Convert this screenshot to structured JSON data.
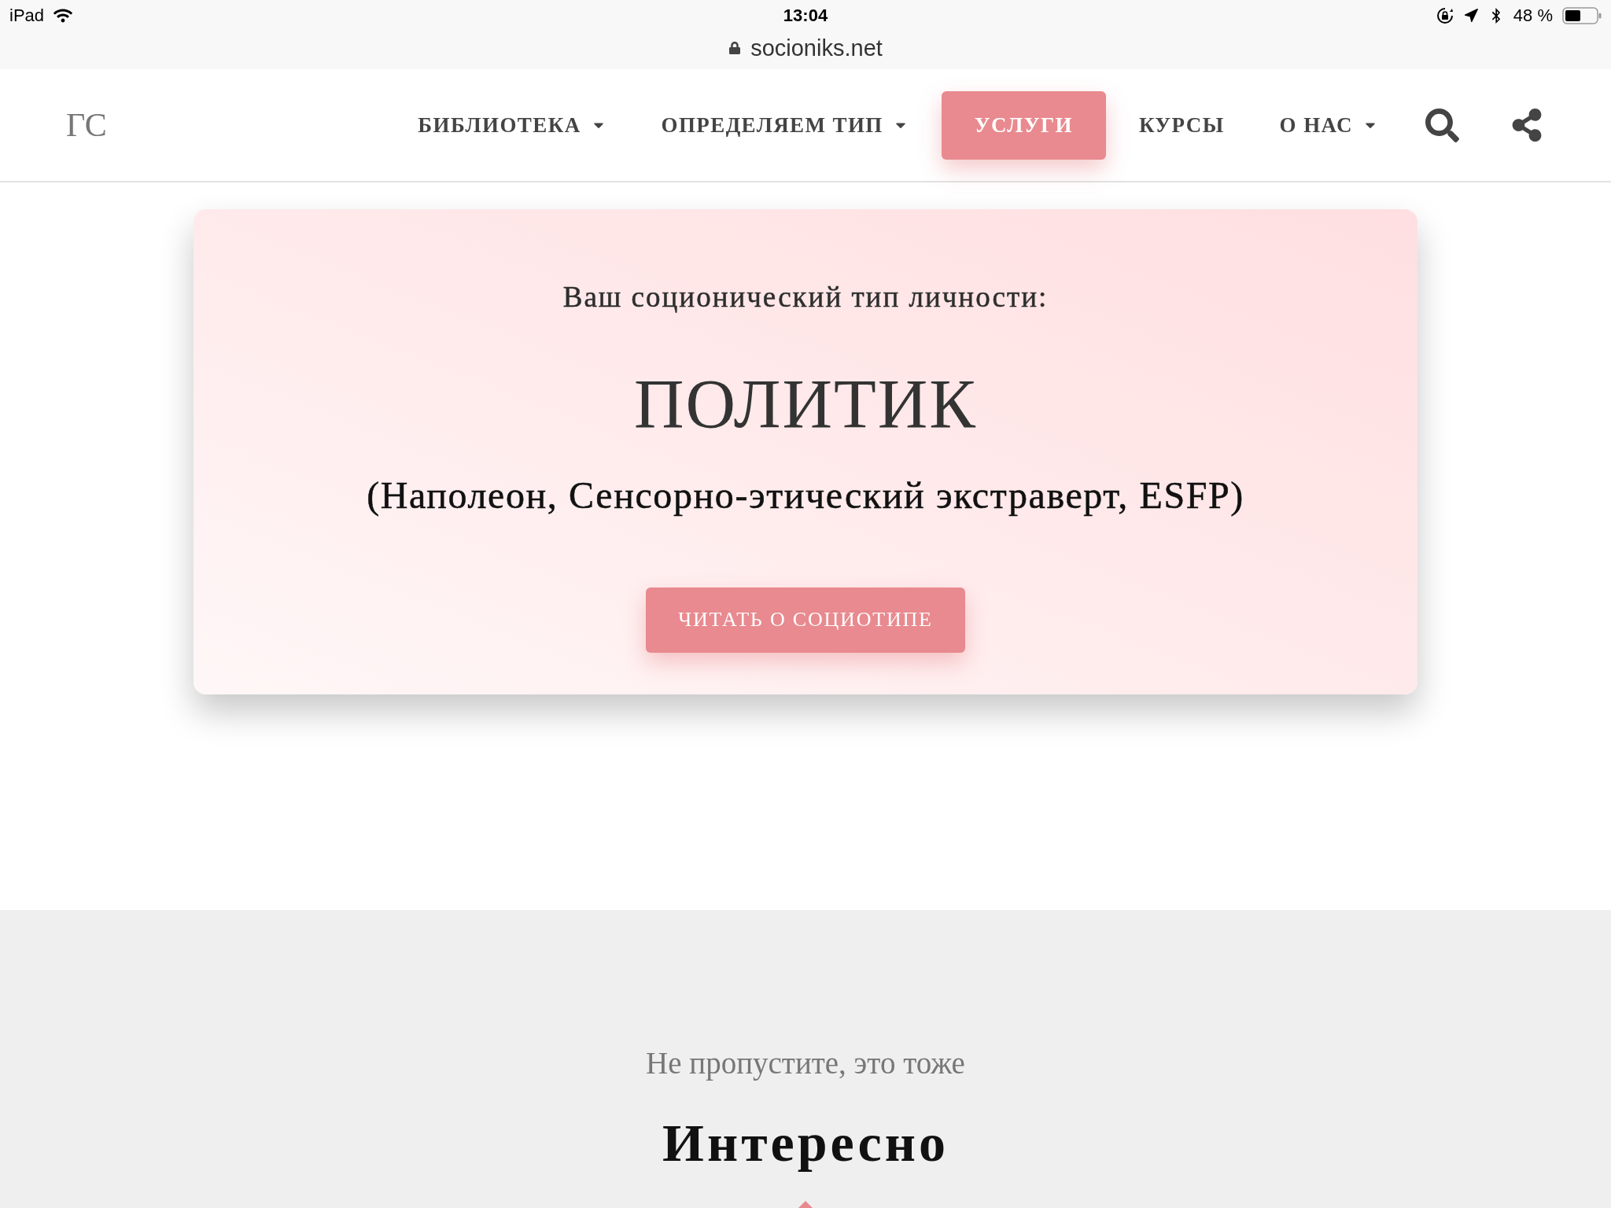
{
  "status_bar": {
    "device": "iPad",
    "time": "13:04",
    "battery": "48 %"
  },
  "address_bar": {
    "url": "socioniks.net"
  },
  "nav": {
    "logo": "ГС",
    "items": [
      {
        "label": "БИБЛИОТЕКА",
        "dropdown": true,
        "selected": false
      },
      {
        "label": "ОПРЕДЕЛЯЕМ ТИП",
        "dropdown": true,
        "selected": false
      },
      {
        "label": "УСЛУГИ",
        "dropdown": false,
        "selected": true
      },
      {
        "label": "КУРСЫ",
        "dropdown": false,
        "selected": false
      },
      {
        "label": "О НАС",
        "dropdown": true,
        "selected": false
      }
    ]
  },
  "result": {
    "intro": "Ваш соционический тип личности:",
    "type": "ПОЛИТИК",
    "details": "(Наполеон, Сенсорно-этический экстраверт, ESFP)",
    "button": "ЧИТАТЬ О СОЦИОТИПЕ"
  },
  "related": {
    "subtitle": "Не пропустите, это тоже",
    "title": "Интересно"
  }
}
